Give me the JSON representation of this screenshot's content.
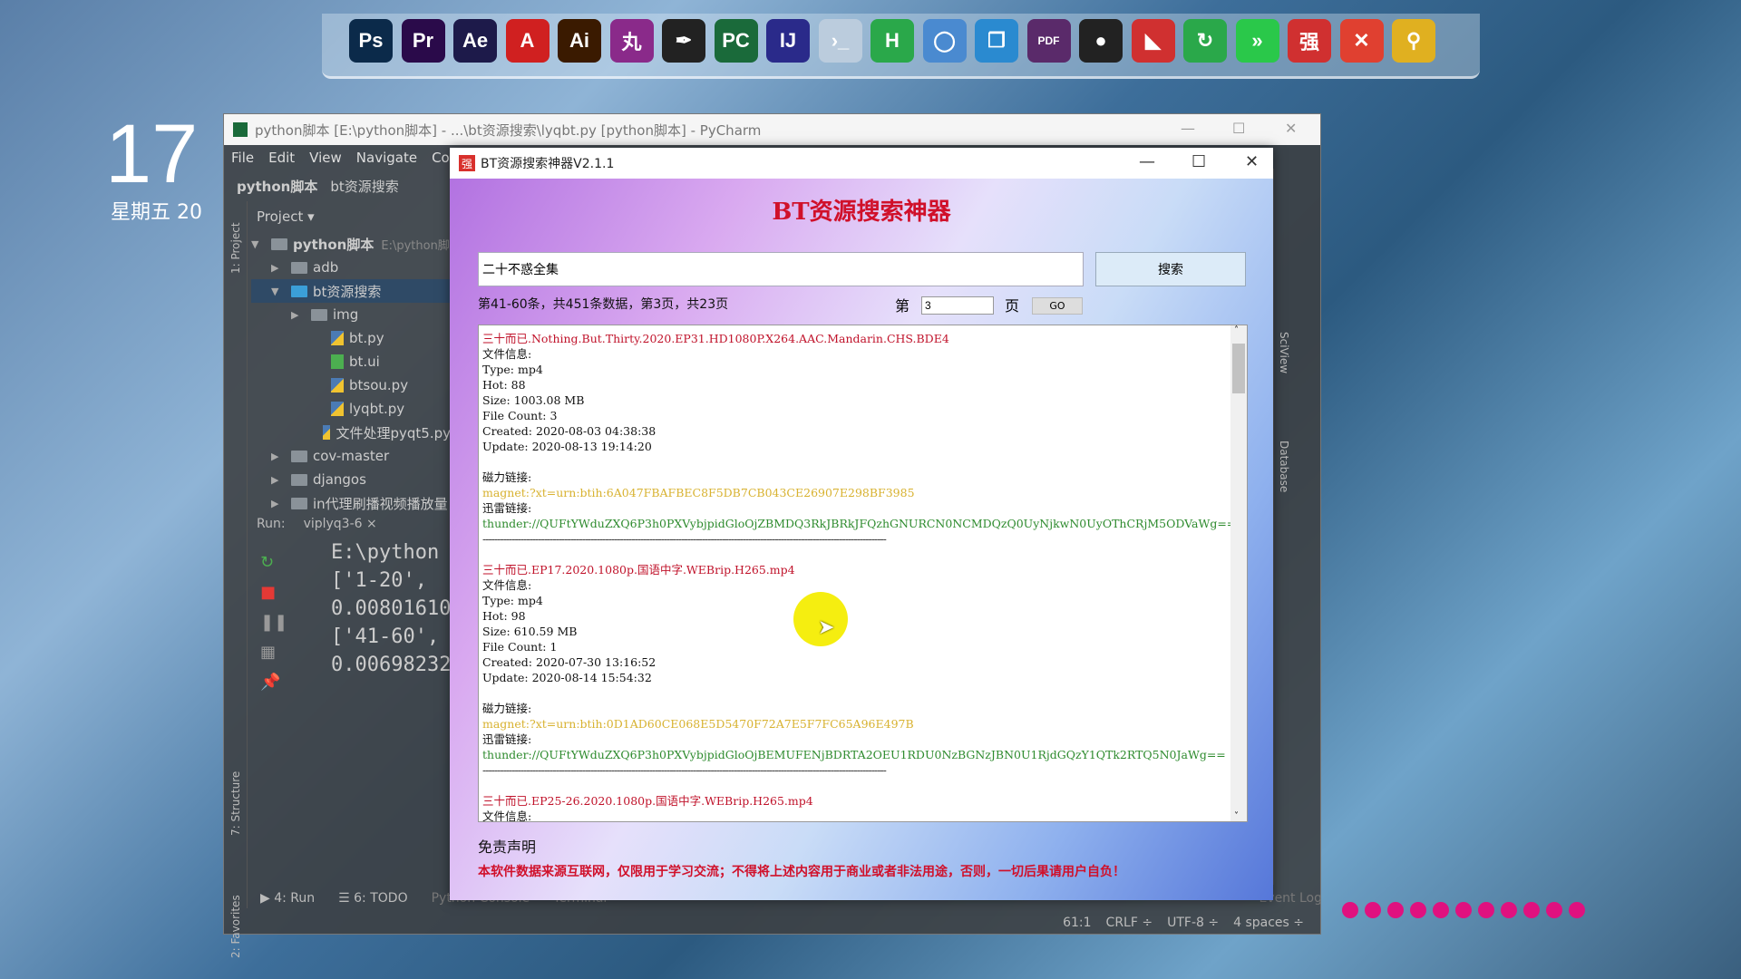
{
  "dock": {
    "icons": [
      {
        "name": "photoshop-icon",
        "label": "Ps",
        "color": "#0b2a4a"
      },
      {
        "name": "premiere-icon",
        "label": "Pr",
        "color": "#2a0a4a"
      },
      {
        "name": "after-effects-icon",
        "label": "Ae",
        "color": "#1d1a4a"
      },
      {
        "name": "acrobat-icon",
        "label": "A",
        "color": "#d02020"
      },
      {
        "name": "illustrator-icon",
        "label": "Ai",
        "color": "#3a1a00"
      },
      {
        "name": "app-icon",
        "label": "丸",
        "color": "#8a2a8a"
      },
      {
        "name": "pen-icon",
        "label": "✒",
        "color": "#222"
      },
      {
        "name": "pycharm-icon",
        "label": "PC",
        "color": "#1a6a3a"
      },
      {
        "name": "intellij-icon",
        "label": "IJ",
        "color": "#2a2a8a"
      },
      {
        "name": "chat-icon",
        "label": "›_",
        "color": "#bcd"
      },
      {
        "name": "hbuilder-icon",
        "label": "H",
        "color": "#2aa84a"
      },
      {
        "name": "circles-icon",
        "label": "◯",
        "color": "#4a8ad0"
      },
      {
        "name": "window-icon",
        "label": "❐",
        "color": "#2a8ad0"
      },
      {
        "name": "pdf-icon",
        "label": "PDF",
        "color": "#5a2a6a"
      },
      {
        "name": "record-icon",
        "label": "●",
        "color": "#222"
      },
      {
        "name": "wps-icon",
        "label": "◣",
        "color": "#d03030"
      },
      {
        "name": "refresh-icon",
        "label": "↻",
        "color": "#2aa84a"
      },
      {
        "name": "arrow-icon",
        "label": "»",
        "color": "#2ac84a"
      },
      {
        "name": "qiang-icon",
        "label": "强",
        "color": "#d03030"
      },
      {
        "name": "xmind-icon",
        "label": "✕",
        "color": "#e04030"
      },
      {
        "name": "search-tool-icon",
        "label": "⚲",
        "color": "#e0b020"
      }
    ]
  },
  "clock": {
    "day": "17",
    "date": "星期五 20"
  },
  "pycharm": {
    "title": "python脚本 [E:\\python脚本] - ...\\bt资源搜索\\lyqbt.py [python脚本] - PyCharm",
    "menu": [
      "File",
      "Edit",
      "View",
      "Navigate",
      "Coc"
    ],
    "breadcrumb": [
      "python脚本",
      "bt资源搜索"
    ],
    "project_label": "Project ▾",
    "side_tabs": [
      "1: Project",
      "7: Structure",
      "2: Favorites"
    ],
    "right_tabs": [
      "SciView",
      "Database"
    ],
    "tree": [
      {
        "label": "python脚本",
        "extra": "E:\\python脚",
        "depth": 0,
        "arrow": "▼",
        "type": "folder"
      },
      {
        "label": "adb",
        "depth": 1,
        "arrow": "▶",
        "type": "folder"
      },
      {
        "label": "bt资源搜索",
        "depth": 1,
        "arrow": "▼",
        "type": "folder",
        "selected": true
      },
      {
        "label": "img",
        "depth": 2,
        "arrow": "▶",
        "type": "folder"
      },
      {
        "label": "bt.py",
        "depth": 3,
        "type": "py"
      },
      {
        "label": "bt.ui",
        "depth": 3,
        "type": "qt"
      },
      {
        "label": "btsou.py",
        "depth": 3,
        "type": "py"
      },
      {
        "label": "lyqbt.py",
        "depth": 3,
        "type": "py"
      },
      {
        "label": "文件处理pyqt5.py",
        "depth": 3,
        "type": "py"
      },
      {
        "label": "cov-master",
        "depth": 1,
        "arrow": "▶",
        "type": "folder"
      },
      {
        "label": "djangos",
        "depth": 1,
        "arrow": "▶",
        "type": "folder"
      },
      {
        "label": "in代理刷播视频播放量",
        "depth": 1,
        "arrow": "▶",
        "type": "folder"
      }
    ],
    "run_label": "Run:",
    "run_tab": "viplyq3-6 ×",
    "console": [
      "E:\\python",
      "['1-20',",
      "0.00801610",
      "['41-60',",
      "0.00698232"
    ],
    "bottom_tabs": [
      "▶ 4: Run",
      "☰ 6: TODO",
      "Python Console",
      "Terminal",
      "Event Log"
    ],
    "status": [
      "61:1",
      "CRLF ÷",
      "UTF-8 ÷",
      "4 spaces ÷"
    ]
  },
  "dialog": {
    "title": "BT资源搜索神器V2.1.1",
    "logo": "强",
    "heading": "BT资源搜索神器",
    "search_value": "二十不惑全集",
    "search_button": "搜索",
    "status": "第41-60条，共451条数据，第3页，共23页",
    "page_prefix": "第",
    "page_value": "3",
    "page_suffix": "页",
    "go_button": "GO",
    "results": [
      {
        "k": "t",
        "s": "三十而已.Nothing.But.Thirty.2020.EP31.HD1080P.X264.AAC.Mandarin.CHS.BDE4"
      },
      {
        "k": "n",
        "s": "文件信息:"
      },
      {
        "k": "n",
        "s": "Type: mp4"
      },
      {
        "k": "n",
        "s": "Hot: 88"
      },
      {
        "k": "n",
        "s": "Size: 1003.08 MB"
      },
      {
        "k": "n",
        "s": "File Count: 3"
      },
      {
        "k": "n",
        "s": "Created: 2020-08-03 04:38:38"
      },
      {
        "k": "n",
        "s": "Update: 2020-08-13 19:14:20"
      },
      {
        "k": "n",
        "s": " "
      },
      {
        "k": "n",
        "s": "磁力链接:"
      },
      {
        "k": "m",
        "s": "magnet:?xt=urn:btih:6A047FBAFBEC8F5DB7CB043CE26907E298BF3985"
      },
      {
        "k": "n",
        "s": "迅雷链接:"
      },
      {
        "k": "x",
        "s": "thunder://QUFtYWduZXQ6P3h0PXVybjpidGloOjZBMDQ3RkJBRkJFQzhGNURCN0NCMDQzQ0UyNjkwN0UyOThCRjM5ODVaWg=="
      },
      {
        "k": "d",
        "s": "------------------------------------------------------------------------------------------------------------------------------------------"
      },
      {
        "k": "n",
        "s": " "
      },
      {
        "k": "t",
        "s": "三十而已.EP17.2020.1080p.国语中字.WEBrip.H265.mp4"
      },
      {
        "k": "n",
        "s": "文件信息:"
      },
      {
        "k": "n",
        "s": "Type: mp4"
      },
      {
        "k": "n",
        "s": "Hot: 98"
      },
      {
        "k": "n",
        "s": "Size: 610.59 MB"
      },
      {
        "k": "n",
        "s": "File Count: 1"
      },
      {
        "k": "n",
        "s": "Created: 2020-07-30 13:16:52"
      },
      {
        "k": "n",
        "s": "Update: 2020-08-14 15:54:32"
      },
      {
        "k": "n",
        "s": " "
      },
      {
        "k": "n",
        "s": "磁力链接:"
      },
      {
        "k": "m",
        "s": "magnet:?xt=urn:btih:0D1AD60CE068E5D5470F72A7E5F7FC65A96E497B"
      },
      {
        "k": "n",
        "s": "迅雷链接:"
      },
      {
        "k": "x",
        "s": "thunder://QUFtYWduZXQ6P3h0PXVybjpidGloOjBEMUFENjBDRTA2OEU1RDU0NzBGNzJBN0U1RjdGQzY1QTk2RTQ5N0JaWg=="
      },
      {
        "k": "d",
        "s": "------------------------------------------------------------------------------------------------------------------------------------------"
      },
      {
        "k": "n",
        "s": " "
      },
      {
        "k": "t",
        "s": "三十而已.EP25-26.2020.1080p.国语中字.WEBrip.H265.mp4"
      },
      {
        "k": "n",
        "s": "文件信息:"
      }
    ],
    "disclaimer_title": "免责声明",
    "disclaimer": "本软件数据来源互联网，仅限用于学习交流；不得将上述内容用于商业或者非法用途，否则，一切后果请用户自负！"
  },
  "colors": {
    "title_red": "#d0102a",
    "magnet": "#d8b230",
    "thunder": "#2e8b2e",
    "dots": "#e0117f"
  }
}
